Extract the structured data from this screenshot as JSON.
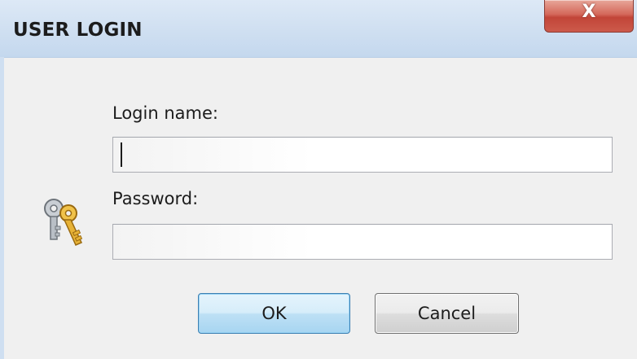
{
  "window": {
    "title": "USER LOGIN",
    "close_label": "X"
  },
  "form": {
    "login_label": "Login name:",
    "login_value": "",
    "password_label": "Password:",
    "password_value": "",
    "icon": "keys-icon"
  },
  "buttons": {
    "ok_label": "OK",
    "cancel_label": "Cancel"
  },
  "colors": {
    "titlebar": "#cfdff1",
    "close_button": "#c24538",
    "ok_border": "#3c7fb1"
  }
}
